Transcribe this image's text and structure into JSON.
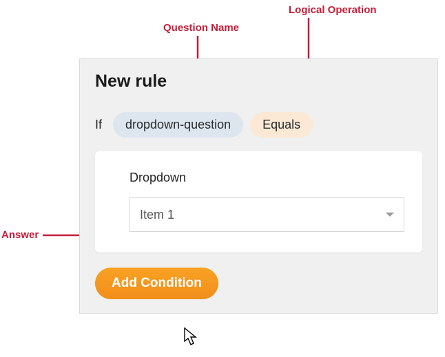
{
  "annotations": {
    "question_name_label": "Question Name",
    "logical_op_label": "Logical Operation",
    "answer_label": "Answer"
  },
  "panel": {
    "title": "New rule",
    "condition": {
      "if_label": "If",
      "question_chip": "dropdown-question",
      "operation_chip": "Equals"
    },
    "answer_card": {
      "field_title": "Dropdown",
      "selected_value": "Item 1"
    },
    "add_button_label": "Add Condition"
  },
  "colors": {
    "annotation": "#c41e3a",
    "chip_question_bg": "#dde6ef",
    "chip_op_bg": "#fbe9d6",
    "primary_button": "#f59a22"
  }
}
